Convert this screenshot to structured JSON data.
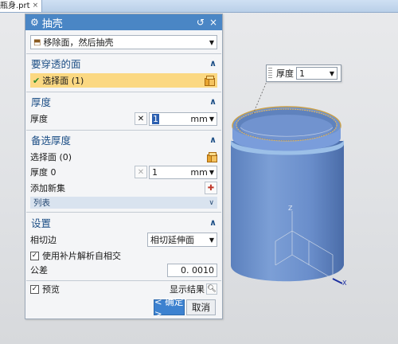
{
  "tab": {
    "title": "瓶身.prt",
    "close": "×"
  },
  "dialog": {
    "title": "抽壳",
    "reset_icon": "↺",
    "close_icon": "×",
    "type_select": "移除面，然后抽壳",
    "faces_section": {
      "title": "要穿透的面",
      "selected": "选择面 (1)"
    },
    "thickness_section": {
      "title": "厚度",
      "label": "厚度",
      "value": "1",
      "unit": "mm"
    },
    "alt_section": {
      "title": "备选厚度",
      "select_face": "选择面 (0)",
      "thickness_label": "厚度 0",
      "thickness_value": "1",
      "unit": "mm",
      "add_new_set": "添加新集",
      "list_label": "列表"
    },
    "settings_section": {
      "title": "设置",
      "tangent_edge_label": "相切边",
      "tangent_edge_value": "相切延伸面",
      "self_intersect_label": "使用补片解析自相交",
      "self_intersect_checked": true,
      "tolerance_label": "公差",
      "tolerance_value": "0. 0010"
    },
    "preview_label": "预览",
    "preview_checked": true,
    "show_result_label": "显示结果",
    "ok_button": "< 确定 >",
    "cancel_button": "取消"
  },
  "viewport": {
    "tooltip_label": "厚度",
    "tooltip_value": "1",
    "axis_z": "Z",
    "axis_x": "X"
  },
  "colors": {
    "title_bar": "#4a86c5",
    "highlight": "#fbd882",
    "ok_button": "#3d82d0",
    "part_body": "#6f93cf"
  }
}
